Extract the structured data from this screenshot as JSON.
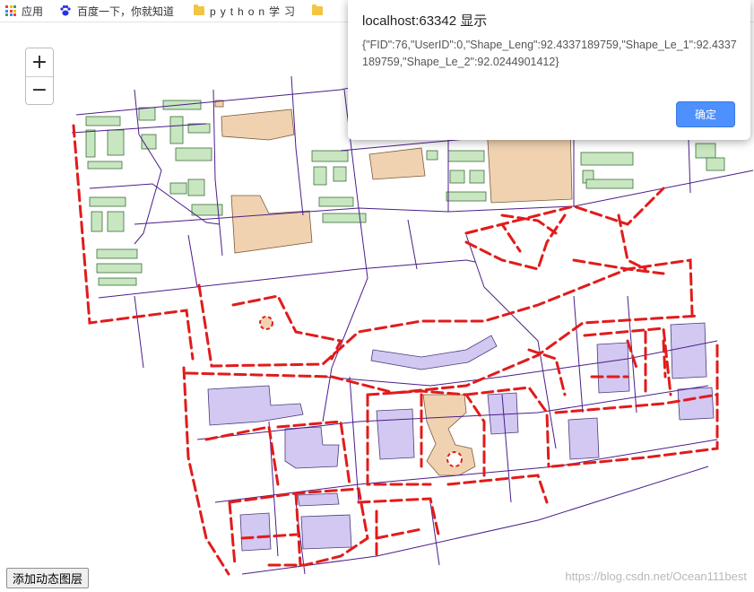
{
  "bookmarks": {
    "items": [
      {
        "label": "应用",
        "icon": "apps-grid-icon"
      },
      {
        "label": "百度一下，你就知道",
        "icon": "baidu-paw-icon"
      },
      {
        "label": "python学习",
        "icon": "folder-icon"
      },
      {
        "label": "",
        "icon": "folder-icon"
      }
    ]
  },
  "map": {
    "zoom_in_label": "+",
    "zoom_out_label": "−",
    "colors": {
      "road_line": "#4b1d8a",
      "dashed_layer": "#e21b1b",
      "building_green": "#c8e6c0",
      "building_tan": "#f0d2b1",
      "building_purple": "#d2c8f2"
    }
  },
  "layer_button": {
    "label": "添加动态图层"
  },
  "dialog": {
    "title": "localhost:63342 显示",
    "message": "{\"FID\":76,\"UserID\":0,\"Shape_Leng\":92.4337189759,\"Shape_Le_1\":92.4337189759,\"Shape_Le_2\":92.0244901412}",
    "ok_label": "确定"
  },
  "watermark": "https://blog.csdn.net/Ocean111best"
}
